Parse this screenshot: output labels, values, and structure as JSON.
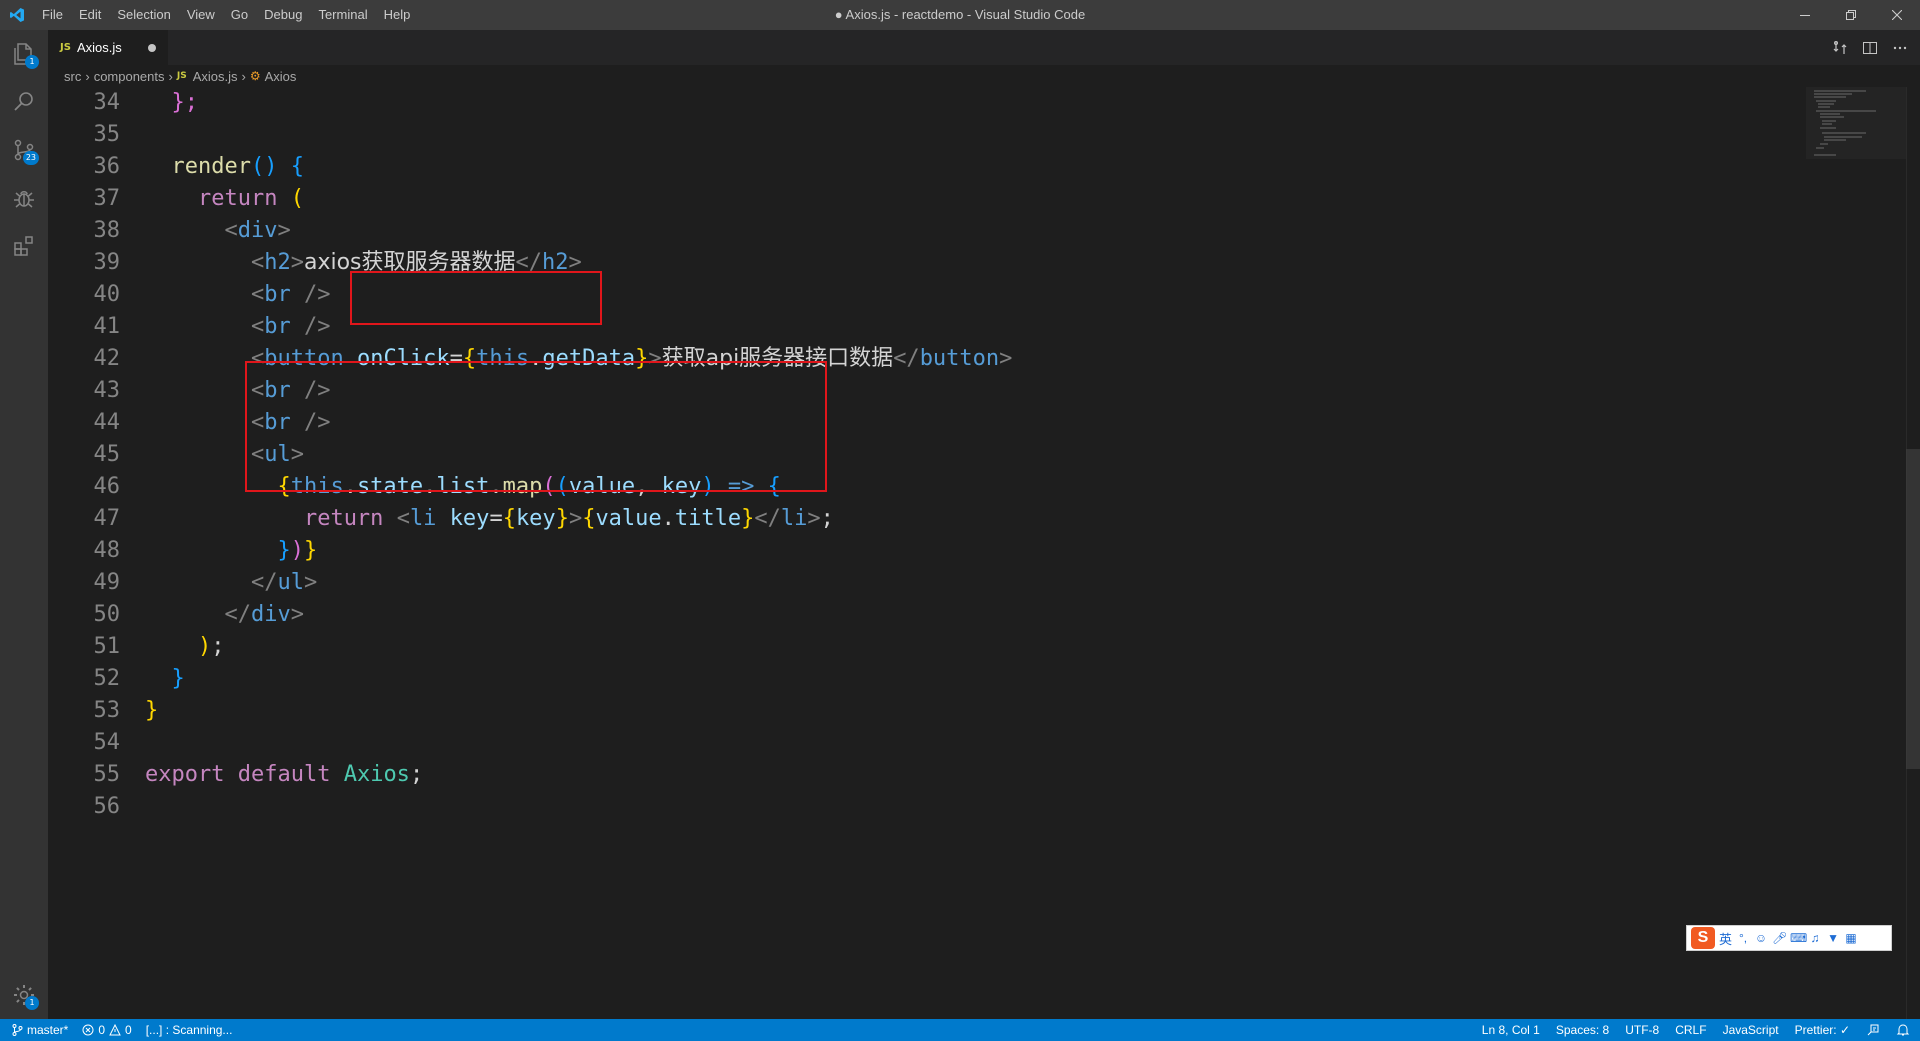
{
  "window": {
    "title": "● Axios.js - reactdemo - Visual Studio Code"
  },
  "menu": [
    "File",
    "Edit",
    "Selection",
    "View",
    "Go",
    "Debug",
    "Terminal",
    "Help"
  ],
  "activity": {
    "explorer_badge": "1",
    "scm_badge": "23",
    "settings_badge": "1"
  },
  "tab": {
    "lang": "JS",
    "name": "Axios.js"
  },
  "breadcrumb": {
    "parts": [
      "src",
      "components"
    ],
    "file_lang": "JS",
    "file": "Axios.js",
    "symbol": "Axios"
  },
  "editor": {
    "line_numbers": [
      "34",
      "35",
      "36",
      "37",
      "38",
      "39",
      "40",
      "41",
      "42",
      "43",
      "44",
      "45",
      "46",
      "47",
      "48",
      "49",
      "50",
      "51",
      "52",
      "53",
      "54",
      "55",
      "56"
    ]
  },
  "code": {
    "l34_a": "    ",
    "l34_b": "};",
    "l36_fn": "render",
    "l36_rest": "() {",
    "l37_kw": "return",
    "l37_rest": " (",
    "l38_tag": "div",
    "l39_tag": "h2",
    "l39_text": "axios获取服务器数据",
    "l40_tag": "br",
    "l41_tag": "br",
    "l42_tag": "button",
    "l42_attr": "onClick",
    "l42_this": "this",
    "l42_fn": "getData",
    "l42_text": "获取api服务器接口数据",
    "l43_tag": "br",
    "l44_tag": "br",
    "l45_tag": "ul",
    "l46_this": "this",
    "l46_state": "state",
    "l46_list": "list",
    "l46_map": "map",
    "l46_value": "value",
    "l46_key": "key",
    "l47_kw": "return",
    "l47_tag": "li",
    "l47_attr": "key",
    "l47_key": "key",
    "l47_value": "value",
    "l47_title": "title",
    "l50_tag": "div",
    "l55_export": "export",
    "l55_default": "default",
    "l55_cls": "Axios"
  },
  "statusbar": {
    "branch": "master*",
    "errors": "0",
    "warnings": "0",
    "scanning": "[...] : Scanning...",
    "position": "Ln 8, Col 1",
    "spaces": "Spaces: 8",
    "encoding": "UTF-8",
    "eol": "CRLF",
    "language": "JavaScript",
    "prettier": "Prettier: ✓"
  },
  "ime": {
    "lang": "英"
  },
  "colors": {
    "accent": "#007acc",
    "highlight_box": "#e0161b"
  }
}
